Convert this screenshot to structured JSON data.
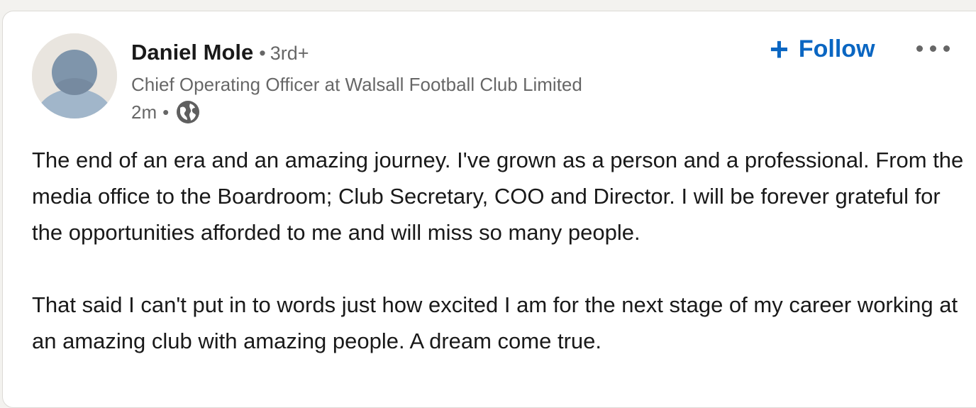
{
  "post": {
    "author": {
      "name": "Daniel Mole",
      "separator": "•",
      "degree": "3rd+",
      "headline": "Chief Operating Officer at Walsall Football Club Limited",
      "avatar_icon": "default-person-avatar-icon"
    },
    "meta": {
      "time": "2m",
      "separator": "•",
      "visibility_icon": "globe-icon"
    },
    "actions": {
      "follow_plus": "+",
      "follow_label": "Follow",
      "more_icon": "more-options-icon"
    },
    "body": {
      "paragraph_1": "The end of an era and an amazing journey. I've grown as a person and a professional. From the media office to the Boardroom; Club Secretary, COO and Director. I will be forever grateful for the opportunities afforded to me and will miss so many people.",
      "paragraph_2": "That said I can't put in to words just how excited I am for the next stage of my career working at an amazing club with amazing people. A dream come true."
    }
  },
  "colors": {
    "background": "#f3f2ef",
    "card": "#ffffff",
    "follow_blue": "#0a66c2",
    "avatar_bg": "#e9e5df",
    "avatar_head": "#7f95ab",
    "avatar_body": "#a1b6ca"
  }
}
